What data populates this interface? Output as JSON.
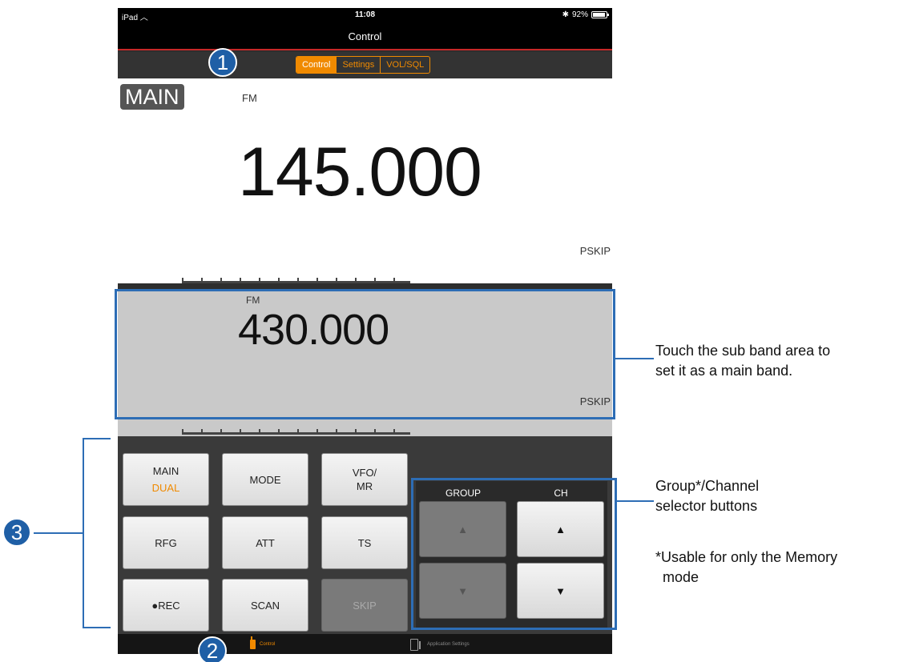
{
  "status_bar": {
    "carrier": "iPad",
    "time": "11:08",
    "battery": "92%"
  },
  "nav": {
    "title": "Control"
  },
  "segments": [
    {
      "label": "Control",
      "active": true
    },
    {
      "label": "Settings",
      "active": false
    },
    {
      "label": "VOL/SQL",
      "active": false
    }
  ],
  "main_band": {
    "badge": "MAIN",
    "mode": "FM",
    "frequency": "145.000",
    "skip": "PSKIP"
  },
  "sub_band": {
    "mode": "FM",
    "frequency": "430.000",
    "skip": "PSKIP"
  },
  "buttons": {
    "main": {
      "label": "MAIN",
      "sub": "DUAL"
    },
    "mode": "MODE",
    "vfo_line1": "VFO/",
    "vfo_line2": "MR",
    "rfg": "RFG",
    "att": "ATT",
    "ts": "TS",
    "rec": "●REC",
    "scan": "SCAN",
    "skip": "SKIP"
  },
  "selector": {
    "group_label": "GROUP",
    "ch_label": "CH",
    "up": "▲",
    "down": "▼"
  },
  "tabs": [
    {
      "label": "Control",
      "active": true
    },
    {
      "label": "Application Settings",
      "active": false
    }
  ],
  "annotations": {
    "callout_1": "1",
    "callout_2": "2",
    "callout_3": "3",
    "sub_band_note_line1": "Touch the sub band area to",
    "sub_band_note_line2": "set it as a main band.",
    "selector_note_line1": "Group*/Channel",
    "selector_note_line2": "selector buttons",
    "memory_note_line1": "*Usable for only the Memory",
    "memory_note_line2": "mode"
  },
  "colors": {
    "accent": "#f08a00",
    "annotation": "#1f5fa6",
    "nav_underline": "#c62828"
  }
}
